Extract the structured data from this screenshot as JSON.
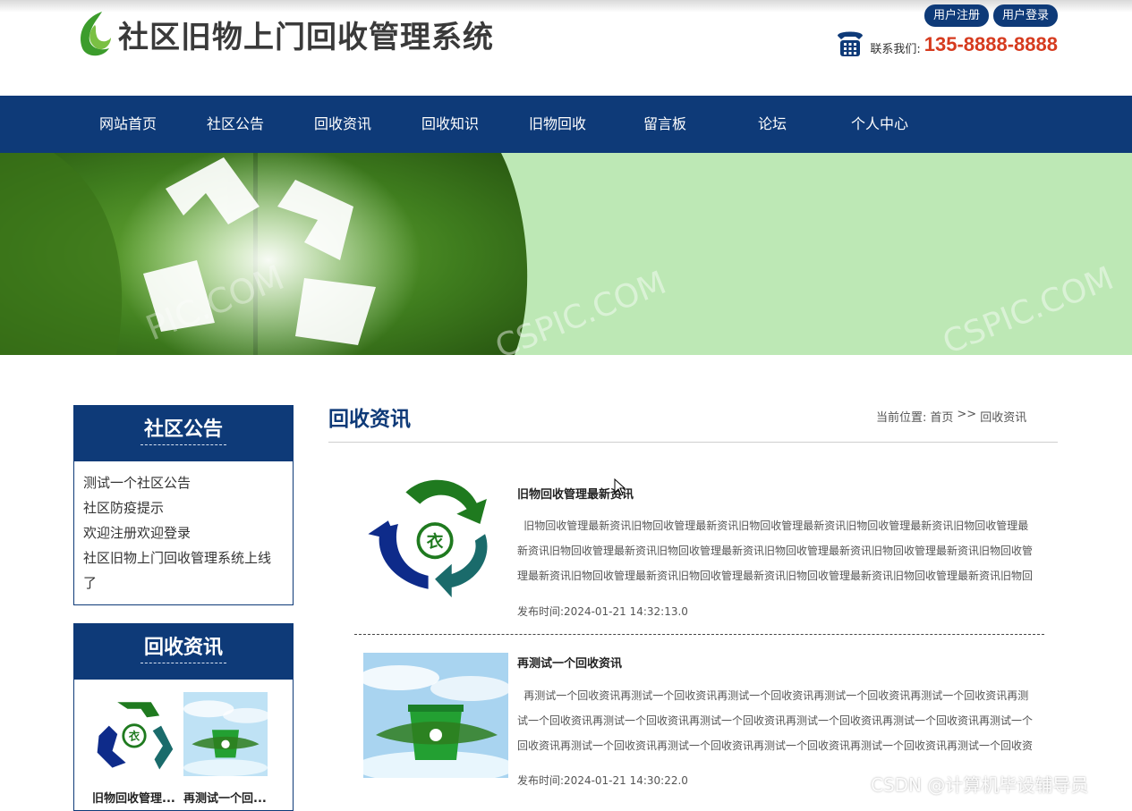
{
  "site": {
    "title": "社区旧物上门回收管理系统",
    "register_label": "用户注册",
    "login_label": "用户登录",
    "contact_label": "联系我们:",
    "contact_phone": "135-8888-8888"
  },
  "nav": {
    "items": [
      "网站首页",
      "社区公告",
      "回收资讯",
      "回收知识",
      "旧物回收",
      "留言板",
      "论坛",
      "个人中心"
    ]
  },
  "banner": {
    "watermark_left": "PIC.COM",
    "watermark_mid": "CSPIC.COM",
    "watermark_right": "CSPIC.COM"
  },
  "sidebar": {
    "notices": {
      "title": "社区公告",
      "items": [
        "测试一个社区公告",
        "社区防疫提示",
        "欢迎注册欢迎登录",
        "社区旧物上门回收管理系统上线了"
      ]
    },
    "news": {
      "title": "回收资讯",
      "items": [
        {
          "caption": "旧物回收管理...",
          "icon": "recycle-clothes-icon"
        },
        {
          "caption": "再测试一个回...",
          "icon": "recycle-bin-image"
        }
      ]
    }
  },
  "main": {
    "title": "回收资讯",
    "breadcrumb": {
      "prefix": "当前位置:",
      "home": "首页",
      "separator": ">>",
      "current": "回收资讯"
    },
    "articles": [
      {
        "title": "旧物回收管理最新资讯",
        "summary": "旧物回收管理最新资讯旧物回收管理最新资讯旧物回收管理最新资讯旧物回收管理最新资讯旧物回收管理最新资讯旧物回收管理最新资讯旧物回收管理最新资讯旧物回收管理最新资讯旧物回收管理最新资讯旧物回收管理最新资讯旧物回收管理最新资讯旧物回收管理最新资讯旧物回收管理最新资讯旧物回收管理最新资讯旧物回",
        "date": "发布时间:2024-01-21 14:32:13.0"
      },
      {
        "title": "再测试一个回收资讯",
        "summary": "再测试一个回收资讯再测试一个回收资讯再测试一个回收资讯再测试一个回收资讯再测试一个回收资讯再测试一个回收资讯再测试一个回收资讯再测试一个回收资讯再测试一个回收资讯再测试一个回收资讯再测试一个回收资讯再测试一个回收资讯再测试一个回收资讯再测试一个回收资讯再测试一个回收资讯再测试一个回收资讯再测试一个回收资",
        "date": "发布时间:2024-01-21 14:30:22.0"
      }
    ]
  },
  "watermark": "CSDN @计算机毕设辅导员",
  "colors": {
    "primary": "#0e3a78",
    "phone": "#d63b1f",
    "banner_green": "#6ca848"
  }
}
